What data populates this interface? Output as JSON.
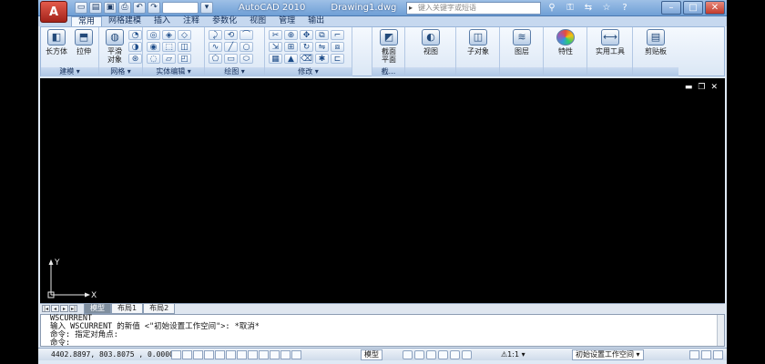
{
  "app": {
    "name": "AutoCAD 2010",
    "document": "Drawing1.dwg",
    "logo": "A",
    "search_placeholder": "键入关键字或短语",
    "workspace_value": ""
  },
  "tabs": [
    "常用",
    "网格建模",
    "插入",
    "注释",
    "参数化",
    "视图",
    "管理",
    "输出"
  ],
  "ribbon": {
    "panels": [
      {
        "title": "建模 ▾"
      },
      {
        "title": "网格 ▾"
      },
      {
        "title": "实体编辑 ▾"
      },
      {
        "title": "绘图 ▾"
      },
      {
        "title": "修改 ▾"
      },
      {
        "title": "截..."
      },
      {
        "title": ""
      },
      {
        "title": ""
      },
      {
        "title": ""
      },
      {
        "title": ""
      },
      {
        "title": ""
      },
      {
        "title": ""
      }
    ],
    "buttons": {
      "box": "长方体",
      "extrude": "拉伸",
      "smooth": "平滑\n对象",
      "section_plane": "截面\n平面",
      "view": "视图",
      "subobject": "子对象",
      "layers": "图层",
      "properties": "特性",
      "utilities": "实用工具",
      "clipboard": "剪贴板"
    }
  },
  "viewport": {
    "ucs_x": "X",
    "ucs_y": "Y"
  },
  "layout_tabs": [
    "模型",
    "布局1",
    "布局2"
  ],
  "command_lines": [
    "WSCURRENT",
    "输入 WSCURRENT 的新值 <\"初始设置工作空间\">: *取消*",
    "命令: 指定对角点:",
    "命令:"
  ],
  "status": {
    "coords": "4402.8897, 803.8075 , 0.0000",
    "model": "模型",
    "scale": "⚠1:1 ▾",
    "workspace": "初始设置工作空间 ▾"
  },
  "colors": {
    "title_bar": "#7aa7dc",
    "ribbon_bg": "#e8f0fa",
    "viewport_bg": "#000000",
    "app_button": "#c0392b"
  }
}
